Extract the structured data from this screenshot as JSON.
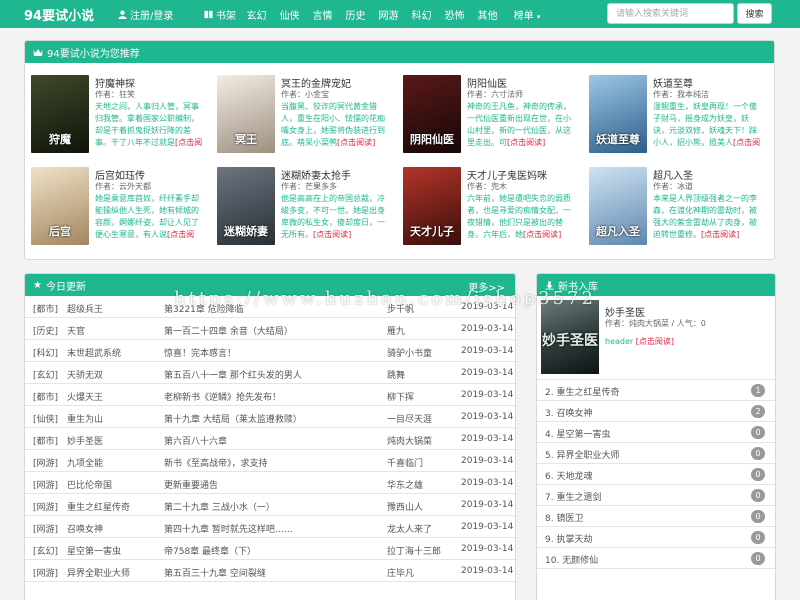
{
  "site": {
    "logo": "94要试小说",
    "login": "注册/登录",
    "nav": [
      "书架",
      "玄幻",
      "仙侠",
      "言情",
      "历史",
      "网游",
      "科幻",
      "恐怖",
      "其他",
      "榜单"
    ],
    "search_placeholder": "请输入搜索关键词",
    "search_button": "搜索"
  },
  "recommend": {
    "title": "94要试小说为您推荐",
    "books": [
      {
        "title": "狩魔神探",
        "author": "作者：狂笑",
        "desc": "天地之间，人事归人管，冥事归我管。拿着国家公职编制，却是干着抓鬼捉妖行降的差事。干了八年不过就是",
        "read": "[点击阅读]",
        "cover_text": "狩魔",
        "c1": "#3e4a2a",
        "c2": "#0f140a"
      },
      {
        "title": "冥王的金牌宠妃",
        "author": "作者：小金宝",
        "desc": "当腹黑、狡诈的冥代黄金猎人，重生在阳小、怯懦的花痴嘴女身上，她誓将伪装进行到底。萌呆小菜鸭",
        "read": "[点击阅读]",
        "cover_text": "冥王",
        "c1": "#f3ede2",
        "c2": "#9c8f80"
      },
      {
        "title": "阴阳仙医",
        "author": "作者：六寸法师",
        "desc": "神奇的王凡鱼，神奇的传承，一代仙医重新出现在世，在小山村里，新的一代仙医，从这里走出。可",
        "read": "[点击阅读]",
        "cover_text": "阴阳仙医",
        "c1": "#5a1a18",
        "c2": "#160606"
      },
      {
        "title": "妖道至尊",
        "author": "作者：我本纯洁",
        "desc": "湿鲵重生，妖皇再现！一个傻子财马，摇身成为妖皇，妖诀，元谈双修，妖魂天下！踩小人，招小熊，揽美人",
        "read": "[点击阅读]",
        "cover_text": "妖道至尊",
        "c1": "#9cc7e6",
        "c2": "#2e5d8a"
      },
      {
        "title": "后宫如珏传",
        "author": "作者：云外天都",
        "desc": "她是乘意库首奴，纤纤素手却能操纵他人生死，她有倾城的容颜，婀娜纤姿，却让人见了便心生寒意，有人说",
        "read": "[点击阅读]",
        "cover_text": "后宫",
        "c1": "#efe2c8",
        "c2": "#a3865e"
      },
      {
        "title": "迷糊娇妻太抢手",
        "author": "作者：芒果多多",
        "desc": "他是高高在上的帝国总裁，冷峻多变，不可一世。她是出身卑微的私生女，傻却度日，一无所有。",
        "read": "[点击阅读]",
        "cover_text": "迷糊娇妻",
        "c1": "#6c7580",
        "c2": "#2a2f36"
      },
      {
        "title": "天才儿子鬼医妈咪",
        "author": "作者：兜木",
        "desc": "六年前，她是遭吧失恋的弱质者，也是寻爱的痴情女配，一夜错情，他们只是被出的替身。六年后，她",
        "read": "[点击阅读]",
        "cover_text": "天才儿子",
        "c1": "#b3352a",
        "c2": "#3a0e0b"
      },
      {
        "title": "超凡入圣",
        "author": "作者：冰道",
        "desc": "本来是人界顶级强者之一的李森，在渡化神期的雷劫时，被强大的紫金雷劫从了肉身，被迫转世重修。",
        "read": "[点击阅读]",
        "cover_text": "超凡入圣",
        "c1": "#cfe3f2",
        "c2": "#5f88b0"
      }
    ]
  },
  "updates": {
    "title": "今日更新",
    "more": "更多>>",
    "rows": [
      {
        "cat": "[都市]",
        "name": "超级兵王",
        "chapter": "第3221章 危险降临",
        "author": "步千帆",
        "date": "2019-03-14"
      },
      {
        "cat": "[历史]",
        "name": "天官",
        "chapter": "第一百二十四章 余音（大结局）",
        "author": "雁九",
        "date": "2019-03-14"
      },
      {
        "cat": "[科幻]",
        "name": "末世超武系统",
        "chapter": "惊喜！完本感言！",
        "author": "骑驴小书童",
        "date": "2019-03-14"
      },
      {
        "cat": "[玄幻]",
        "name": "天骄无双",
        "chapter": "第五百八十一章 那个红头发的男人",
        "author": "跳舞",
        "date": "2019-03-14"
      },
      {
        "cat": "[都市]",
        "name": "火爆天王",
        "chapter": "老柳新书《逆鳞》抢先发布！",
        "author": "柳下挥",
        "date": "2019-03-14"
      },
      {
        "cat": "[仙侠]",
        "name": "重生为山",
        "chapter": "第十九章 大结局（莱太监遵救赎）",
        "author": "一目尽天涯",
        "date": "2019-03-14"
      },
      {
        "cat": "[都市]",
        "name": "妙手圣医",
        "chapter": "第六百八十六章",
        "author": "炖肉大锅菜",
        "date": "2019-03-14"
      },
      {
        "cat": "[网游]",
        "name": "九项全能",
        "chapter": "新书《至高战帝》，求支持",
        "author": "千喜临门",
        "date": "2019-03-14"
      },
      {
        "cat": "[网游]",
        "name": "巴比伦帝国",
        "chapter": "更新重要通告",
        "author": "华东之雄",
        "date": "2019-03-14"
      },
      {
        "cat": "[网游]",
        "name": "重生之红星传奇",
        "chapter": "第二十九章 三战小水（一）",
        "author": "豫西山人",
        "date": "2019-03-14"
      },
      {
        "cat": "[网游]",
        "name": "召唤女神",
        "chapter": "第四十九章 暂时就先这样吧……",
        "author": "龙太人来了",
        "date": "2019-03-14"
      },
      {
        "cat": "[玄幻]",
        "name": "星空第一害虫",
        "chapter": "帝758章 最终章（下）",
        "author": "拉丁海十三郎",
        "date": "2019-03-14"
      },
      {
        "cat": "[网游]",
        "name": "异界全职业大师",
        "chapter": "第五百三十九章 空间裂缝",
        "author": "庄毕凡",
        "date": "2019-03-14"
      }
    ]
  },
  "newbooks": {
    "title": "新书入库",
    "top": {
      "title": "妙手圣医",
      "meta": "作者：炖肉大锅菜 / 人气：0",
      "intro": "header",
      "read": "[点击阅读]",
      "cover_text": "妙手圣医"
    },
    "ranks": [
      {
        "title": "2. 重生之红星传奇",
        "count": "1"
      },
      {
        "title": "3. 召唤女神",
        "count": "2"
      },
      {
        "title": "4. 星空第一害虫",
        "count": "0"
      },
      {
        "title": "5. 异界全职业大师",
        "count": "0"
      },
      {
        "title": "6. 天地龙魂",
        "count": "0"
      },
      {
        "title": "7. 重生之遗剑",
        "count": "0"
      },
      {
        "title": "8. 镜医卫",
        "count": "0"
      },
      {
        "title": "9. 执掌天劫",
        "count": "0"
      },
      {
        "title": "10. 无颜修仙",
        "count": "0"
      }
    ]
  },
  "watermark": "https://www.huzhan.com/ishop3572",
  "colors": {
    "accent": "#1fb78f",
    "read_link": "#e0223c",
    "badge": "#999999"
  }
}
